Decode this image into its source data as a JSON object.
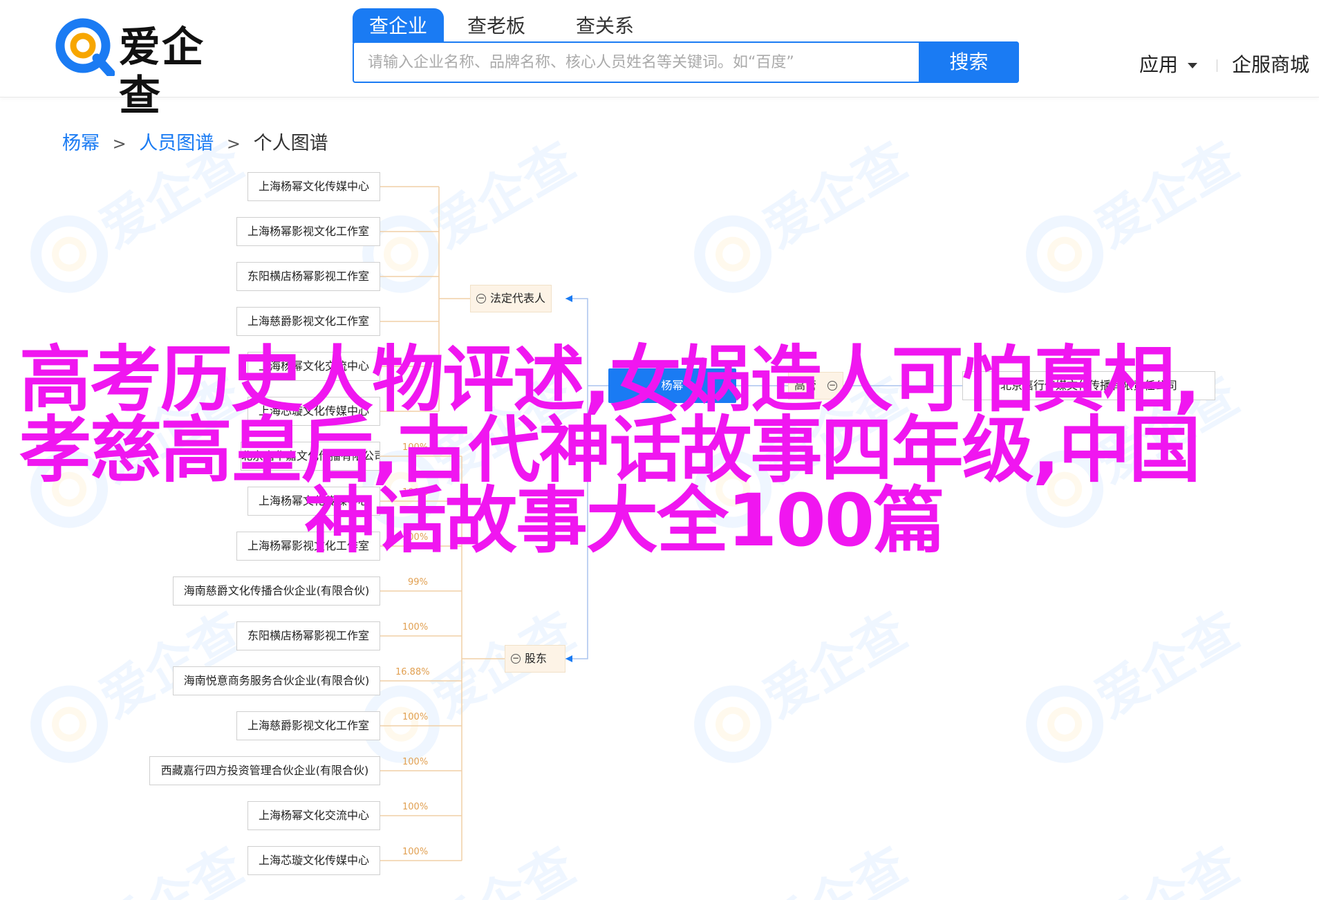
{
  "header": {
    "logo_text": "爱企查",
    "tabs": [
      {
        "label": "查企业",
        "active": true
      },
      {
        "label": "查老板",
        "active": false
      },
      {
        "label": "查关系",
        "active": false
      }
    ],
    "search": {
      "placeholder": "请输入企业名称、品牌名称、核心人员姓名等关键词。如“百度”",
      "button_label": "搜索"
    },
    "nav": {
      "apps_label": "应用",
      "mall_label": "企服商城"
    }
  },
  "breadcrumb": {
    "items": [
      "杨幂",
      "人员图谱",
      "个人图谱"
    ],
    "separator": ">"
  },
  "graph": {
    "legal_rep_group": {
      "label": "法定代表人",
      "toggle": "−"
    },
    "shareholder_group": {
      "label": "股东",
      "toggle": "−"
    },
    "center": {
      "label": "杨幂"
    },
    "right_group": {
      "label": "高管",
      "toggle": "−"
    },
    "right_company": {
      "label": "北京嘉行传媒文化传播有限责任公司"
    },
    "legal_rep_companies": [
      {
        "label": "上海杨幂文化传媒中心"
      },
      {
        "label": "上海杨幂影视文化工作室"
      },
      {
        "label": "东阳横店杨幂影视工作室"
      },
      {
        "label": "上海慈爵影视文化工作室"
      },
      {
        "label": "上海杨幂文化交流中心"
      },
      {
        "label": "上海芯璇文化传媒中心"
      }
    ],
    "shareholder_companies": [
      {
        "label": "北京嘉华嘉文化传播有限公司",
        "pct": "100%"
      },
      {
        "label": "上海杨幂文化传媒中心",
        "pct": "100%"
      },
      {
        "label": "上海杨幂影视文化工作室",
        "pct": "100%"
      },
      {
        "label": "海南慈爵文化传播合伙企业(有限合伙)",
        "pct": "99%"
      },
      {
        "label": "东阳横店杨幂影视工作室",
        "pct": "100%"
      },
      {
        "label": "海南悦意商务服务合伙企业(有限合伙)",
        "pct": "16.88%"
      },
      {
        "label": "上海慈爵影视文化工作室",
        "pct": "100%"
      },
      {
        "label": "西藏嘉行四方投资管理合伙企业(有限合伙)",
        "pct": "100%"
      },
      {
        "label": "上海杨幂文化交流中心",
        "pct": "100%"
      },
      {
        "label": "上海芯璇文化传媒中心",
        "pct": "100%"
      }
    ]
  },
  "overlay": {
    "lines": [
      "高考历史人物评述,女娲造人可怕真相,",
      "孝慈高皇后,古代神话故事四年级,中国",
      "神话故事大全100篇"
    ],
    "color": "#f016f0"
  },
  "colors": {
    "accent": "#1a7bf3",
    "group_bg": "#fdf3e6",
    "percent": "#e1a052"
  }
}
